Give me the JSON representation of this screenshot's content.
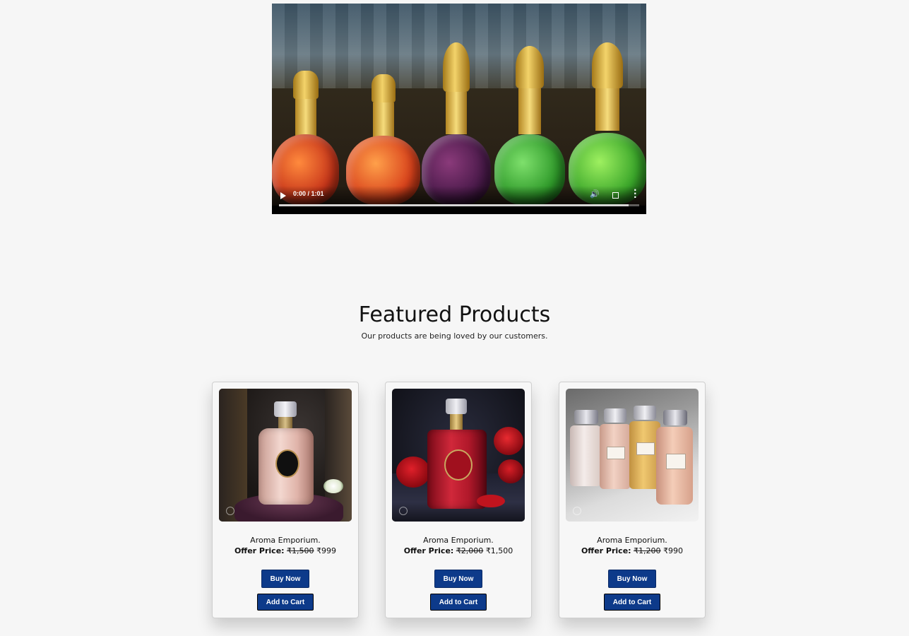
{
  "video": {
    "time": "0:00 / 1:01",
    "progress_fraction": 0.0,
    "icons": [
      "play-icon",
      "volume-icon",
      "fullscreen-icon",
      "more-options-icon"
    ]
  },
  "featured": {
    "title": "Featured Products",
    "subtitle": "Our products are being loved by our customers."
  },
  "products": [
    {
      "name": "Aroma Emporium.",
      "offer_label": "Offer Price:",
      "old_price": "₹1,500",
      "new_price": "₹999",
      "buy_label": "Buy Now",
      "cart_label": "Add to Cart"
    },
    {
      "name": "Aroma Emporium.",
      "offer_label": "Offer Price:",
      "old_price": "₹2,000",
      "new_price": "₹1,500",
      "buy_label": "Buy Now",
      "cart_label": "Add to Cart"
    },
    {
      "name": "Aroma Emporium.",
      "offer_label": "Offer Price:",
      "old_price": "₹1,200",
      "new_price": "₹990",
      "buy_label": "Buy Now",
      "cart_label": "Add to Cart"
    }
  ],
  "colors": {
    "page_background": "#f6f6f6",
    "button_background": "#0d3a8a",
    "button_text": "#ffffff"
  }
}
